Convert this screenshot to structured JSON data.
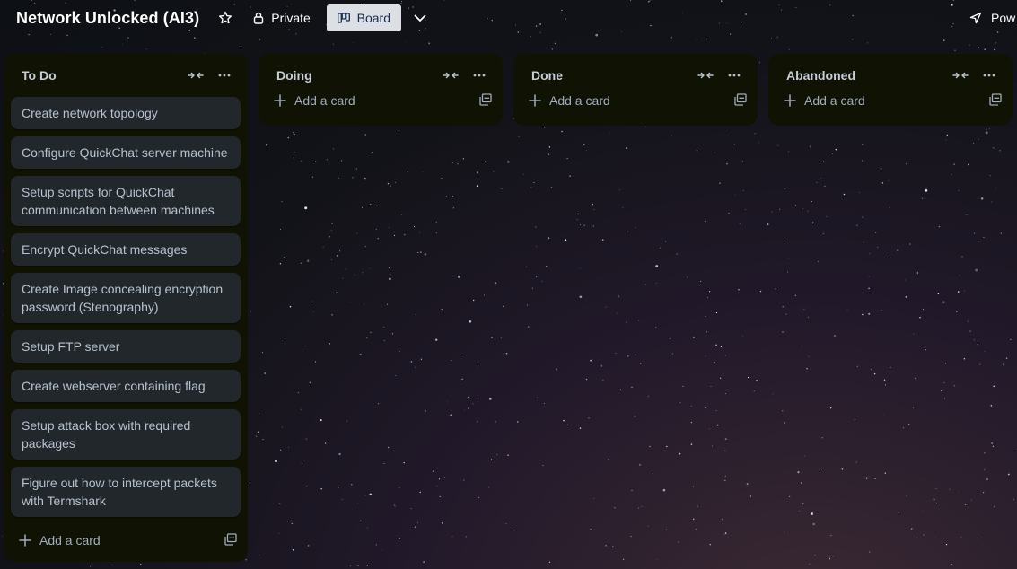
{
  "header": {
    "board_title": "Network Unlocked (AI3)",
    "visibility_label": "Private",
    "view_label": "Board",
    "powerups_label": "Pow"
  },
  "lists": [
    {
      "title": "To Do",
      "cards": [
        "Create network topology",
        "Configure QuickChat server machine",
        "Setup scripts for QuickChat communication between machines",
        "Encrypt QuickChat messages",
        "Create Image concealing encryption password (Stenography)",
        "Setup FTP server",
        "Create webserver containing flag",
        "Setup attack box with required packages",
        "Figure out how to intercept packets with Termshark"
      ],
      "add_label": "Add a card"
    },
    {
      "title": "Doing",
      "cards": [],
      "add_label": "Add a card"
    },
    {
      "title": "Done",
      "cards": [],
      "add_label": "Add a card"
    },
    {
      "title": "Abandoned",
      "cards": [],
      "add_label": "Add a card"
    }
  ],
  "icons": {
    "star": "star-icon",
    "lock": "lock-icon",
    "board": "board-icon",
    "chevron": "chevron-down-icon",
    "powerups": "rocket-icon",
    "collapse": "collapse-icon",
    "more": "more-icon",
    "plus": "plus-icon",
    "template": "template-icon"
  },
  "colors": {
    "list_bg": "#101204",
    "card_bg": "#22272b",
    "card_text": "#b6c2cf",
    "board_button_bg": "#dcdfe4"
  }
}
